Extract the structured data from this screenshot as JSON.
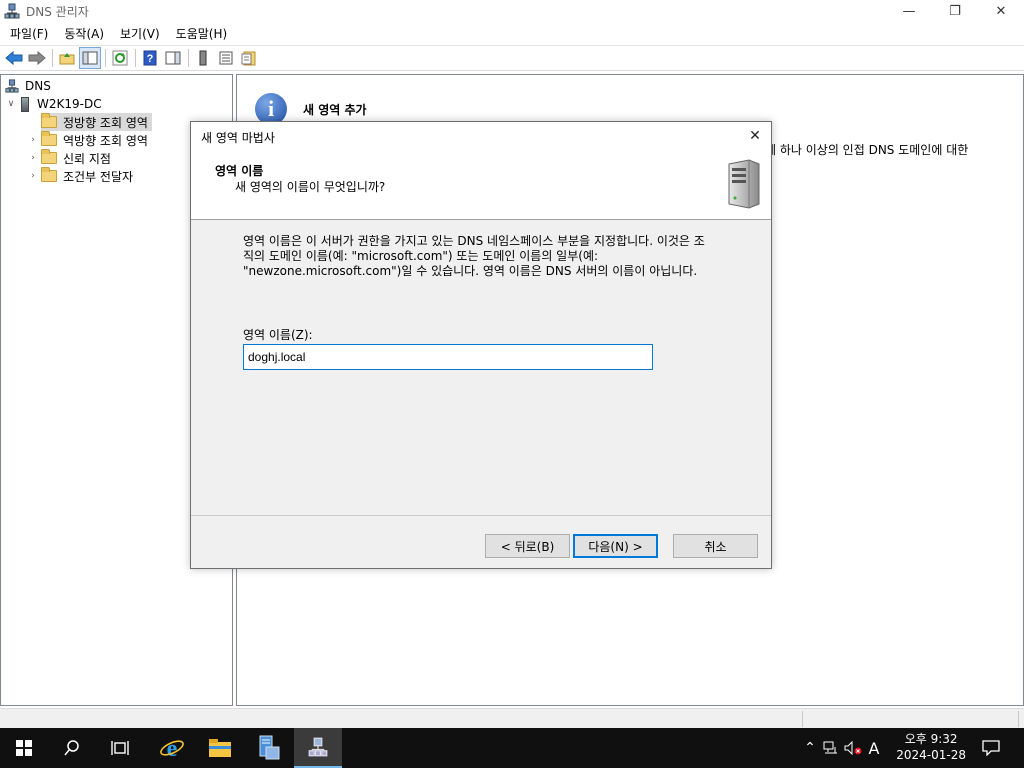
{
  "window": {
    "title": "DNS 관리자",
    "controls": {
      "minimize": "—",
      "maximize": "❐",
      "close": "✕"
    }
  },
  "menu": [
    "파일(F)",
    "동작(A)",
    "보기(V)",
    "도움말(H)"
  ],
  "toolbar": {
    "icons": [
      "back-icon",
      "forward-icon",
      "up-folder-icon",
      "show-hide-tree-icon",
      "refresh-icon",
      "help-icon",
      "action-pane-icon",
      "server-icon",
      "list-icon",
      "properties-icon"
    ]
  },
  "tree": {
    "root": "DNS",
    "server": "W2K19-DC",
    "items": [
      {
        "label": "정방향 조회 영역",
        "selected": true
      },
      {
        "label": "역방향 조회 영역"
      },
      {
        "label": "신뢰 지점"
      },
      {
        "label": "조건부 전달자"
      }
    ]
  },
  "right_pane": {
    "title": "새 영역 추가",
    "text": "에 하나 이상의 인접 DNS 도메인에 대한"
  },
  "dialog": {
    "title": "새 영역 마법사",
    "header_title": "영역 이름",
    "header_subtitle": "새 영역의 이름이 무엇입니까?",
    "description": [
      "영역 이름은 이 서버가 권한을 가지고 있는 DNS 네임스페이스 부분을 지정합니다. 이것은 조",
      "직의 도메인 이름(예: \"microsoft.com\") 또는 도메인 이름의 일부(예:",
      "\"newzone.microsoft.com\")일 수 있습니다. 영역 이름은 DNS 서버의 이름이 아닙니다."
    ],
    "field_label": "영역 이름(Z):",
    "field_value": "doghj.local",
    "buttons": {
      "back": "< 뒤로(B)",
      "next": "다음(N) >",
      "cancel": "취소"
    }
  },
  "taskbar": {
    "items": [
      "start-icon",
      "search-icon",
      "task-view-icon",
      "internet-explorer-icon",
      "file-explorer-icon",
      "server-manager-icon",
      "dns-manager-icon"
    ],
    "ime": "A",
    "time": "오후 9:32",
    "date": "2024-01-28"
  },
  "colors": {
    "accent": "#0078d7",
    "dialog_bg": "#f0f0f0",
    "taskbar": "#101010",
    "folder": "#f4d47a"
  }
}
